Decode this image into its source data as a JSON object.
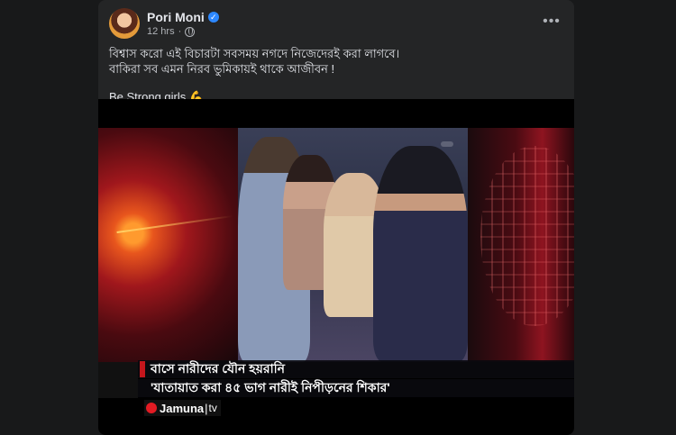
{
  "post": {
    "author": "Pori Moni",
    "time": "12 hrs",
    "more_label": "•••",
    "text_line1": "বিশ্বাস করো এই বিচারটা সবসময় নগদে নিজেদেরই করা লাগবে।",
    "text_line2": "বাকিরা সব এমন নিরব ভুমিকায়ই থাকে আজীবন !",
    "text_line3": "Be Strong girls",
    "emoji": "💪"
  },
  "video": {
    "caption_line1": "বাসে নারীদের যৌন হয়রানি",
    "caption_line2": "'যাতায়াত করা ৪৫ ভাগ নারীই নিপীড়নের শিকার'",
    "logo_text": "Jamuna",
    "logo_sep": "|",
    "logo_tv": "tv"
  },
  "colors": {
    "background": "#18191a",
    "card": "#242526",
    "verified": "#2d88ff",
    "caption_red": "#c4161c"
  },
  "icons": [
    "verified-badge-icon",
    "globe-icon",
    "more-options-icon"
  ]
}
